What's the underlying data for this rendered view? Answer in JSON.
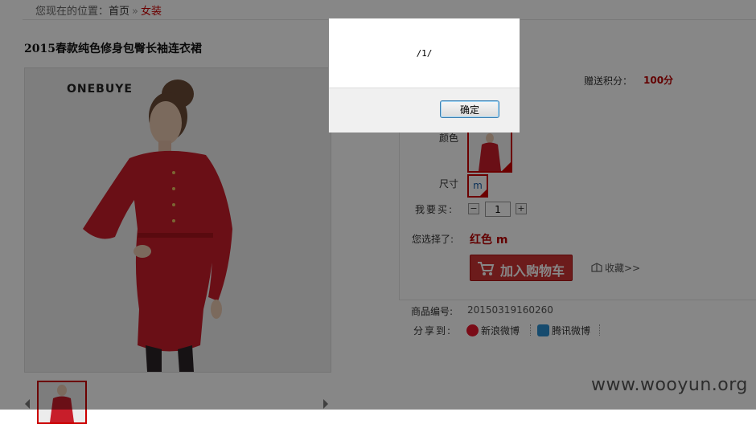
{
  "breadcrumb": {
    "prefix": "您现在的位置：",
    "home": "首页",
    "separator": "»",
    "current": "女装"
  },
  "product": {
    "title": "2015春款纯色修身包臀长袖连衣裙",
    "brand_text": "ONEBUYE",
    "points_label": "赠送积分：",
    "points_value": "100分"
  },
  "options": {
    "color_label": "颜色",
    "size_label": "尺寸",
    "size_value": "m",
    "quantity_label": "我要买:",
    "quantity_value": "1",
    "selected_label": "您选择了:",
    "selected_value": "红色 m"
  },
  "actions": {
    "add_to_cart": "加入购物车",
    "favorite": "收藏>>"
  },
  "info": {
    "sku_label": "商品编号:",
    "sku_value": "20150319160260",
    "share_label": "分享到:",
    "share_sina": "新浪微博",
    "share_tencent": "腾讯微博"
  },
  "dialog": {
    "message": "/1/",
    "ok_label": "确定"
  },
  "watermark": "www.wooyun.org",
  "colors": {
    "accent": "#cc0000",
    "cart_button": "#cc3333",
    "overlay": "rgba(0,0,0,0.47)"
  },
  "icons": [
    "cart-icon",
    "favorite-icon",
    "weibo-icon",
    "tencent-weibo-icon",
    "minus-icon",
    "plus-icon",
    "arrow-left-icon",
    "arrow-right-icon"
  ]
}
